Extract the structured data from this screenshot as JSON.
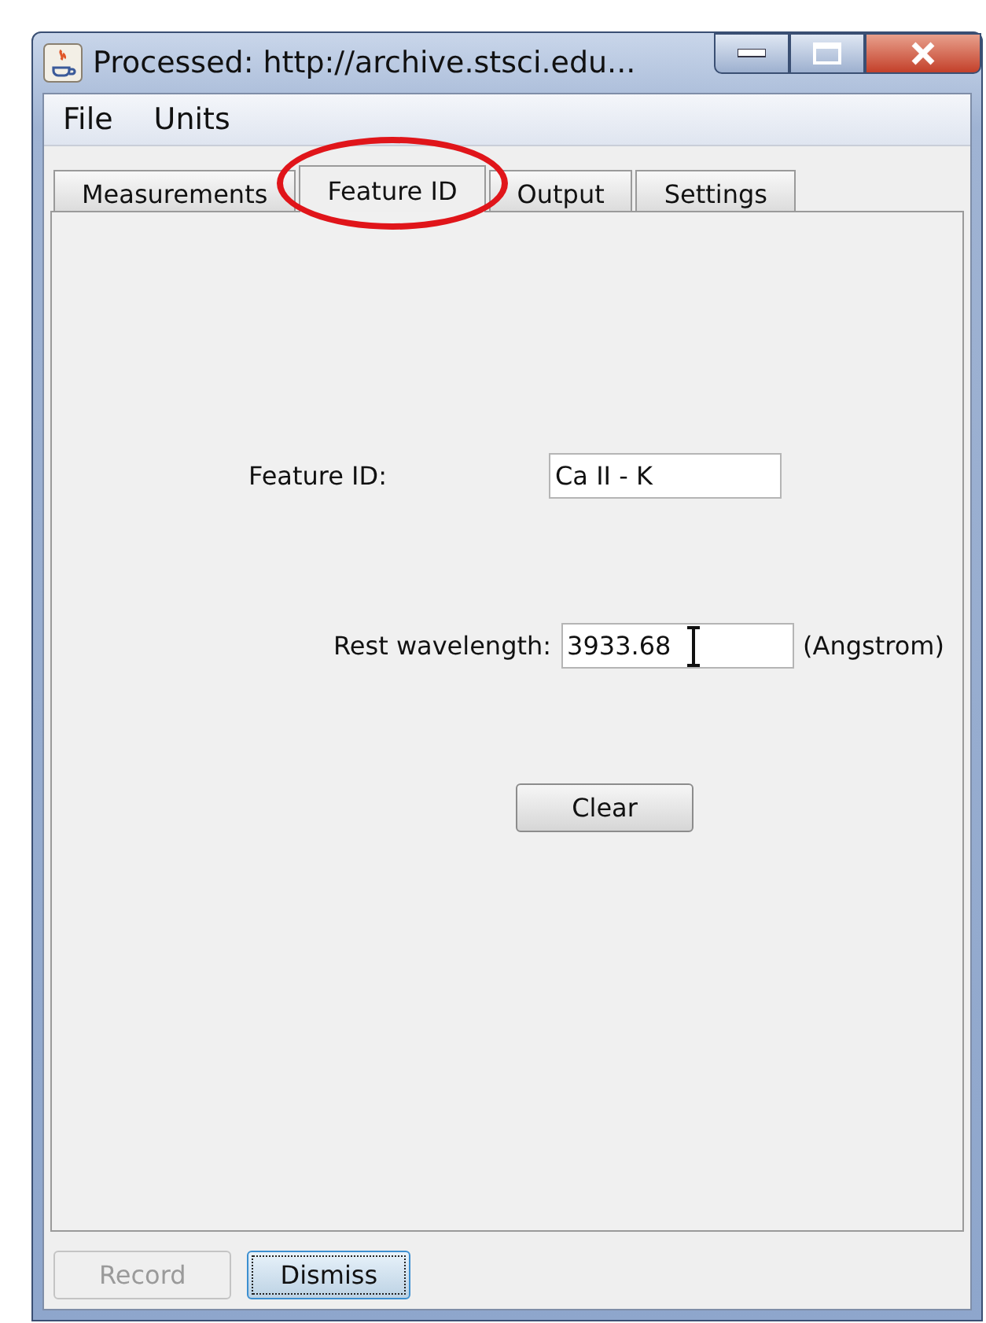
{
  "window": {
    "title": "Processed: http://archive.stsci.edu..."
  },
  "menu": [
    "File",
    "Units"
  ],
  "tabs": [
    {
      "label": "Measurements",
      "selected": false,
      "circled": false
    },
    {
      "label": "Feature ID",
      "selected": true,
      "circled": true
    },
    {
      "label": "Output",
      "selected": false,
      "circled": false
    },
    {
      "label": "Settings",
      "selected": false,
      "circled": false
    }
  ],
  "form": {
    "feature_id": {
      "label": "Feature ID:",
      "value": "Ca II - K"
    },
    "rest_wavelength": {
      "label": "Rest wavelength:",
      "value": "3933.68",
      "unit": "(Angstrom)"
    },
    "clear_button": "Clear"
  },
  "buttons": [
    {
      "label": "Record",
      "disabled": true,
      "focused": false
    },
    {
      "label": "Dismiss",
      "disabled": false,
      "focused": true
    }
  ]
}
